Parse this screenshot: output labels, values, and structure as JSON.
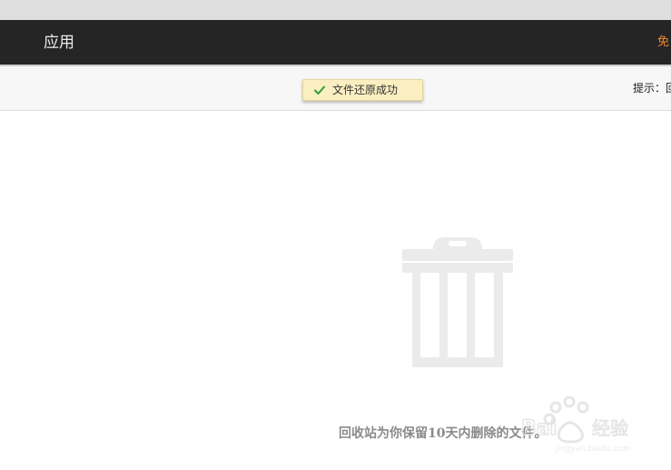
{
  "header": {
    "apps_label": "应用",
    "right_link_label": "免"
  },
  "toast": {
    "icon": "check-icon",
    "message": "文件还原成功"
  },
  "tip": {
    "text": "提示：回"
  },
  "empty_state": {
    "icon": "trash-can-icon",
    "message": "回收站为你保留10天内删除的文件。"
  },
  "colors": {
    "header_bg": "#252525",
    "toast_bg": "#fbeec0",
    "accent_orange": "#f08a2a",
    "success_green": "#2e9e3b"
  }
}
